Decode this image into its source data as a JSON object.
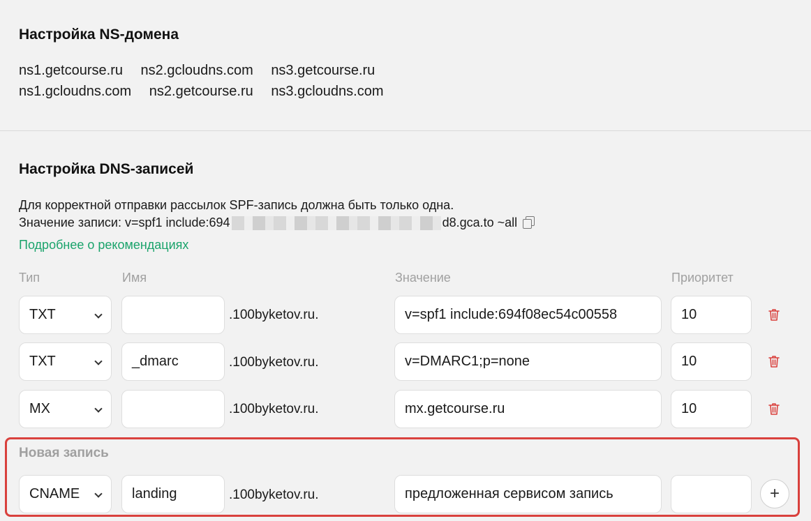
{
  "ns_section": {
    "title": "Настройка NS-домена",
    "servers_row1": [
      "ns1.getcourse.ru",
      "ns2.gcloudns.com",
      "ns3.getcourse.ru"
    ],
    "servers_row2": [
      "ns1.gcloudns.com",
      "ns2.getcourse.ru",
      "ns3.gcloudns.com"
    ]
  },
  "dns_section": {
    "title": "Настройка DNS-записей",
    "note_line1": "Для корректной отправки рассылок SPF-запись должна быть только одна.",
    "note_prefix": "Значение записи: v=spf1 include:694",
    "note_suffix": "d8.gca.to ~all",
    "link": "Подробнее о рекомендациях",
    "columns": {
      "type": "Тип",
      "name": "Имя",
      "value": "Значение",
      "priority": "Приоритет"
    },
    "domain_suffix": ".100byketov.ru.",
    "records": [
      {
        "type": "TXT",
        "name": "",
        "value": "v=spf1 include:694f08ec54c00558",
        "priority": "10"
      },
      {
        "type": "TXT",
        "name": "_dmarc",
        "value": "v=DMARC1;p=none",
        "priority": "10"
      },
      {
        "type": "MX",
        "name": "",
        "value": "mx.getcourse.ru",
        "priority": "10"
      }
    ],
    "new_record": {
      "label": "Новая запись",
      "type": "CNAME",
      "name": "landing",
      "value": "предложенная сервисом запись",
      "priority": ""
    },
    "add_icon": "+",
    "colors": {
      "link": "#1aa36b",
      "trash": "#d9413d",
      "highlight": "#d9413d"
    }
  }
}
